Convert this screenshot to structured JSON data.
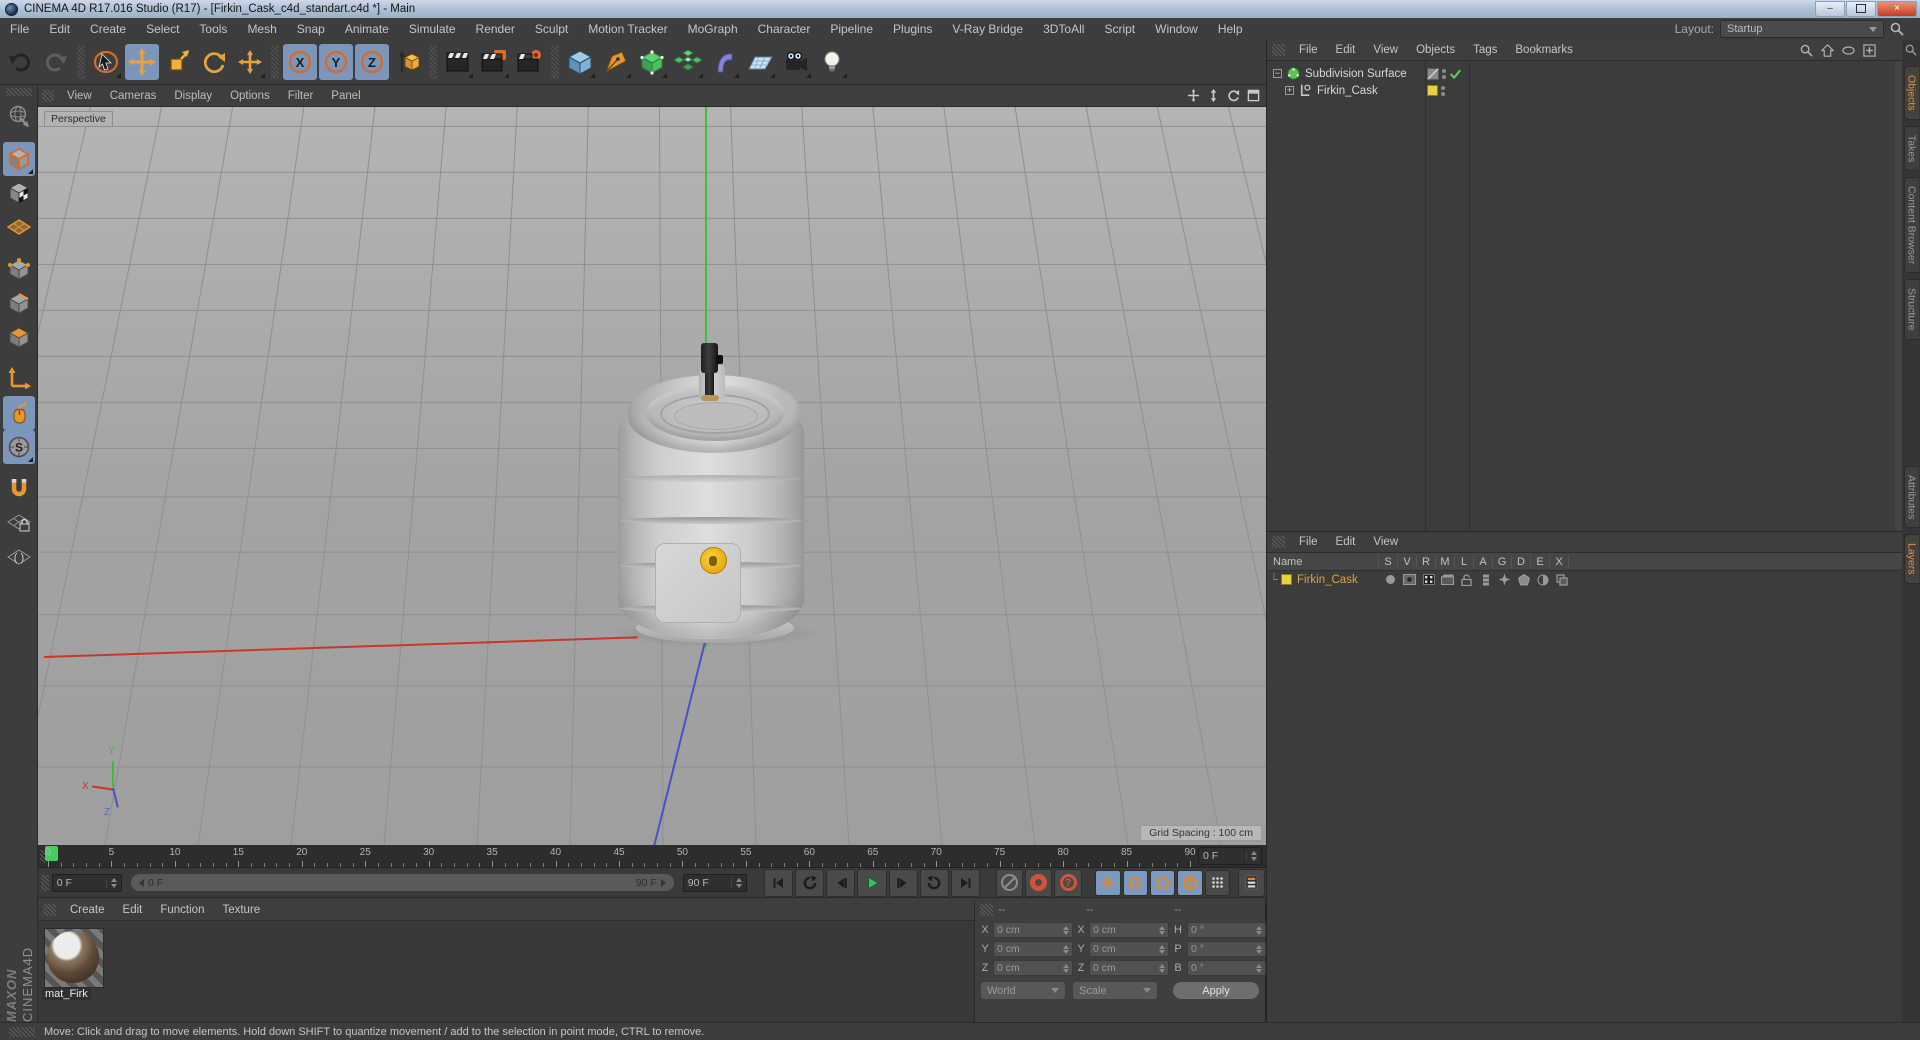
{
  "window": {
    "title": "CINEMA 4D R17.016 Studio (R17) - [Firkin_Cask_c4d_standart.c4d *] - Main",
    "minimize_glyph": "–",
    "close_glyph": "×"
  },
  "menubar": {
    "items": [
      "File",
      "Edit",
      "Create",
      "Select",
      "Tools",
      "Mesh",
      "Snap",
      "Animate",
      "Simulate",
      "Render",
      "Sculpt",
      "Motion Tracker",
      "MoGraph",
      "Character",
      "Pipeline",
      "Plugins",
      "V-Ray Bridge",
      "3DToAll",
      "Script",
      "Window",
      "Help"
    ],
    "layout_label": "Layout:",
    "layout_value": "Startup"
  },
  "toolbar": {
    "axis_x": "X",
    "axis_y": "Y",
    "axis_z": "Z",
    "icons": [
      "undo-icon",
      "redo-icon",
      "live-selection-icon",
      "move-icon",
      "scale-icon",
      "rotate-icon",
      "free-move-icon",
      "lock-x-axis-icon",
      "lock-y-axis-icon",
      "lock-z-axis-icon",
      "coordinate-system-icon",
      "render-view-icon",
      "render-picture-viewer-icon",
      "edit-render-settings-icon",
      "add-cube-icon",
      "pen-spline-icon",
      "subdivision-surface-icon",
      "array-icon",
      "bend-deformer-icon",
      "floor-icon",
      "camera-icon",
      "light-icon"
    ]
  },
  "left_toolbar": {
    "icons": [
      "make-editable-icon",
      "model-mode-icon",
      "texture-mode-icon",
      "workplane-mode-icon",
      "points-mode-icon",
      "edges-mode-icon",
      "polygons-mode-icon",
      "enable-axis-icon",
      "viewport-snap-icon",
      "snap-settings-icon",
      "magnet-icon",
      "lock-workplane-icon",
      "planar-workplane-icon"
    ]
  },
  "viewport": {
    "menu": [
      "View",
      "Cameras",
      "Display",
      "Options",
      "Filter",
      "Panel"
    ],
    "label": "Perspective",
    "grid_spacing": "Grid Spacing : 100 cm",
    "axis_y": "Y",
    "axis_x": "X",
    "axis_z": "Z"
  },
  "object_manager": {
    "menu": [
      "File",
      "Edit",
      "View",
      "Objects",
      "Tags",
      "Bookmarks"
    ],
    "items": [
      {
        "name": "Subdivision Surface"
      },
      {
        "name": "Firkin_Cask"
      }
    ]
  },
  "side_tabs": {
    "top": [
      "Objects",
      "Takes",
      "Content Browser",
      "Structure"
    ],
    "top_active": "Objects",
    "bottom": [
      "Attributes",
      "Layers"
    ],
    "bottom_active": "Layers"
  },
  "layer_manager": {
    "menu": [
      "File",
      "Edit",
      "View"
    ],
    "name_column": "Name",
    "columns": [
      "S",
      "V",
      "R",
      "M",
      "L",
      "A",
      "G",
      "D",
      "E",
      "X"
    ],
    "rows": [
      {
        "name": "Firkin_Cask"
      }
    ]
  },
  "timeline": {
    "tick_min": 0,
    "tick_max": 90,
    "label_step": 5,
    "frame_field": "0 F",
    "current_frame": "0 F",
    "range_start": "0 F",
    "range_end": "90 F",
    "end_frame": "90 F"
  },
  "materials": {
    "menu": [
      "Create",
      "Edit",
      "Function",
      "Texture"
    ],
    "items": [
      {
        "name": "mat_Firk"
      }
    ]
  },
  "coordinates": {
    "headers": [
      "--",
      "--",
      "--"
    ],
    "position": {
      "x_label": "X",
      "x": "0 cm",
      "y_label": "Y",
      "y": "0 cm",
      "z_label": "Z",
      "z": "0 cm"
    },
    "size": {
      "x_label": "X",
      "x": "0 cm",
      "y_label": "Y",
      "y": "0 cm",
      "z_label": "Z",
      "z": "0 cm"
    },
    "rotation": {
      "h_label": "H",
      "h": "0 °",
      "p_label": "P",
      "p": "0 °",
      "b_label": "B",
      "b": "0 °"
    },
    "space": "World",
    "mode": "Scale",
    "apply": "Apply"
  },
  "status": {
    "text": "Move: Click and drag to move elements. Hold down SHIFT to quantize movement / add to the selection in point mode, CTRL to remove."
  },
  "branding": {
    "maxon": "MAXON",
    "cinema": "CINEMA4D"
  },
  "colors": {
    "accent_orange": "#e8953c",
    "active_blue": "#7b96ba",
    "selection_yellow": "#e8d23a",
    "axis_green": "#3ec03e",
    "axis_red": "#c8362c",
    "axis_blue": "#4653c8",
    "play_green": "#3fbf63"
  }
}
